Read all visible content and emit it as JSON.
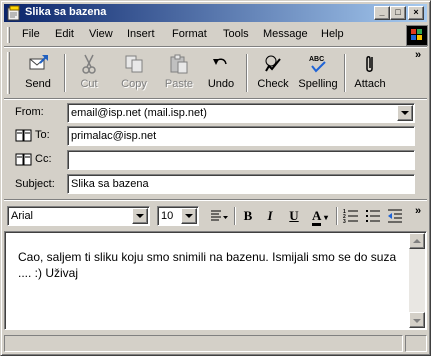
{
  "window": {
    "title": "Slika sa bazena"
  },
  "menu": {
    "items": [
      {
        "label": "File"
      },
      {
        "label": "Edit"
      },
      {
        "label": "View"
      },
      {
        "label": "Insert"
      },
      {
        "label": "Format"
      },
      {
        "label": "Tools"
      },
      {
        "label": "Message"
      },
      {
        "label": "Help"
      }
    ]
  },
  "toolbar": {
    "send": "Send",
    "cut": "Cut",
    "copy": "Copy",
    "paste": "Paste",
    "undo": "Undo",
    "check": "Check",
    "spelling": "Spelling",
    "attach": "Attach",
    "more": "»"
  },
  "header": {
    "from_label": "From:",
    "from_value": "email@isp.net    (mail.isp.net)",
    "to_label": "To:",
    "to_value": "primalac@isp.net",
    "cc_label": "Cc:",
    "cc_value": "",
    "subject_label": "Subject:",
    "subject_value": "Slika sa bazena"
  },
  "format": {
    "font": "Arial",
    "size": "10",
    "bold": "B",
    "italic": "I",
    "underline": "U",
    "font_color": "A"
  },
  "body": {
    "text": "Cao, saljem ti sliku koju smo snimili na bazenu. Ismijali smo se do suza .... :) Uživaj"
  },
  "colors": {
    "titlebar_start": "#0a246a",
    "titlebar_end": "#a6caf0",
    "face": "#d4d0c8"
  },
  "icons": [
    "envelope-icon",
    "send-icon",
    "cut-icon",
    "copy-icon",
    "paste-icon",
    "undo-icon",
    "check-icon",
    "spelling-icon",
    "attach-icon",
    "address-book-icon",
    "windows-logo-icon"
  ]
}
